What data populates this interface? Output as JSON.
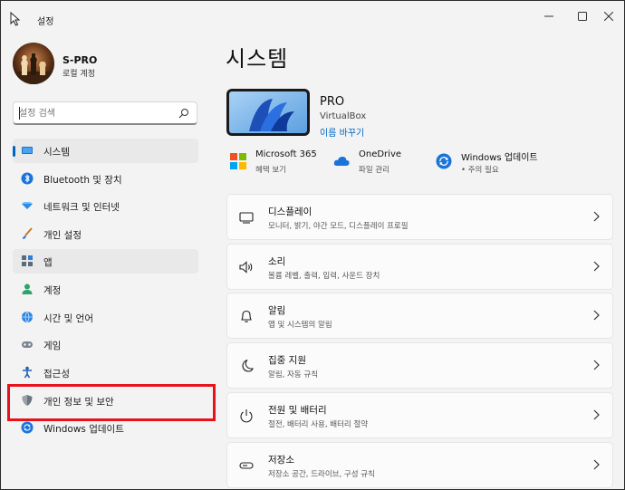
{
  "window": {
    "title": "설정"
  },
  "profile": {
    "name": "S-PRO",
    "account_type": "로컬 계정"
  },
  "search": {
    "placeholder": "설정 검색"
  },
  "sidebar": {
    "items": [
      {
        "label": "시스템",
        "icon": "system-display-icon"
      },
      {
        "label": "Bluetooth 및 장치",
        "icon": "bluetooth-icon"
      },
      {
        "label": "네트워크 및 인터넷",
        "icon": "wifi-diamond-icon"
      },
      {
        "label": "개인 설정",
        "icon": "paintbrush-icon"
      },
      {
        "label": "앱",
        "icon": "apps-icon"
      },
      {
        "label": "계정",
        "icon": "person-icon"
      },
      {
        "label": "시간 및 언어",
        "icon": "globe-clock-icon"
      },
      {
        "label": "게임",
        "icon": "gamepad-icon"
      },
      {
        "label": "접근성",
        "icon": "accessibility-icon"
      },
      {
        "label": "개인 정보 및 보안",
        "icon": "shield-icon"
      },
      {
        "label": "Windows 업데이트",
        "icon": "windows-update-icon"
      }
    ]
  },
  "main": {
    "page_title": "시스템",
    "device": {
      "name": "PRO",
      "model": "VirtualBox",
      "rename_label": "이름 바꾸기"
    },
    "quick_links": [
      {
        "title": "Microsoft 365",
        "subtitle": "혜택 보기",
        "icon": "microsoft-logo-icon"
      },
      {
        "title": "OneDrive",
        "subtitle": "파일 관리",
        "icon": "onedrive-cloud-icon"
      },
      {
        "title": "Windows 업데이트",
        "subtitle": "• 주의 필요",
        "icon": "windows-update-icon"
      }
    ],
    "cards": [
      {
        "title": "디스플레이",
        "subtitle": "모니터, 밝기, 야간 모드, 디스플레이 프로필",
        "icon": "monitor-icon"
      },
      {
        "title": "소리",
        "subtitle": "볼륨 레벨, 출력, 입력, 사운드 장치",
        "icon": "speaker-icon"
      },
      {
        "title": "알림",
        "subtitle": "앱 및 시스템의 알림",
        "icon": "bell-icon"
      },
      {
        "title": "집중 지원",
        "subtitle": "알림, 자동 규칙",
        "icon": "moon-icon"
      },
      {
        "title": "전원 및 배터리",
        "subtitle": "절전, 배터리 사용, 배터리 절약",
        "icon": "power-icon"
      },
      {
        "title": "저장소",
        "subtitle": "저장소 공간, 드라이브, 구성 규칙",
        "icon": "storage-drive-icon"
      }
    ]
  },
  "colors": {
    "accent": "#0067c0",
    "highlight_box": "#e8121d",
    "background": "#f3f3f3"
  }
}
